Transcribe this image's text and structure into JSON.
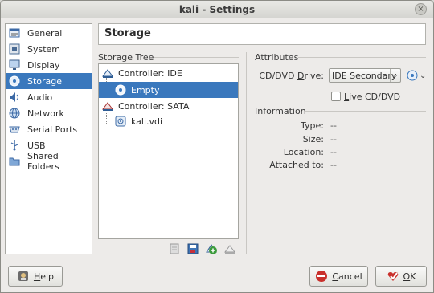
{
  "window": {
    "title": "kali - Settings",
    "close_glyph": "×"
  },
  "sidebar": {
    "items": [
      {
        "label": "General",
        "icon": "general-icon"
      },
      {
        "label": "System",
        "icon": "system-icon"
      },
      {
        "label": "Display",
        "icon": "display-icon"
      },
      {
        "label": "Storage",
        "icon": "storage-icon",
        "selected": true
      },
      {
        "label": "Audio",
        "icon": "audio-icon"
      },
      {
        "label": "Network",
        "icon": "network-icon"
      },
      {
        "label": "Serial Ports",
        "icon": "serial-ports-icon"
      },
      {
        "label": "USB",
        "icon": "usb-icon"
      },
      {
        "label": "Shared Folders",
        "icon": "shared-folders-icon"
      }
    ]
  },
  "page": {
    "title": "Storage"
  },
  "storage_tree": {
    "label": "Storage Tree",
    "controller_ide": "Controller: IDE",
    "ide_child": "Empty",
    "controller_sata": "Controller: SATA",
    "sata_child": "kali.vdi"
  },
  "attributes": {
    "label": "Attributes",
    "drive_label_pre": "CD/DVD ",
    "drive_label_u": "D",
    "drive_label_post": "rive:",
    "drive_value": "IDE Secondary",
    "combo_arrow": "⌵",
    "disc_arrow": "⌄",
    "live_pre": "",
    "live_u": "L",
    "live_post": "ive CD/DVD"
  },
  "information": {
    "label": "Information",
    "rows": [
      {
        "label": "Type:",
        "value": "--"
      },
      {
        "label": "Size:",
        "value": "--"
      },
      {
        "label": "Location:",
        "value": "--"
      },
      {
        "label": "Attached to:",
        "value": "--"
      }
    ]
  },
  "buttons": {
    "help_u": "H",
    "help_rest": "elp",
    "cancel_u": "C",
    "cancel_rest": "ancel",
    "ok_u": "O",
    "ok_rest": "K"
  },
  "colors": {
    "selection": "#3a78bd",
    "window_bg": "#edebe9"
  }
}
